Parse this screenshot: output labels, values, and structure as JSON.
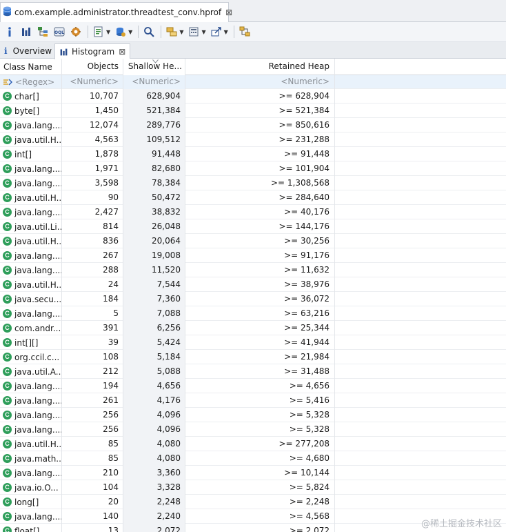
{
  "editor_tab": {
    "title": "com.example.administrator.threadtest_conv.hprof",
    "close": "⊠",
    "icon": "database-icon"
  },
  "toolbar": {
    "buttons": [
      "info-icon",
      "histogram-icon",
      "dominator-tree-icon",
      "oql-icon",
      "thread-overview-icon",
      "run-report-icon",
      "query-browser-icon",
      "find-object-icon",
      "group-by-icon",
      "calculate-retained-icon",
      "export-icon",
      "heap-dump-overview-icon"
    ],
    "oql_label": "OQL"
  },
  "view_tabs": [
    {
      "label": "Overview",
      "icon": "i"
    },
    {
      "label": "Histogram",
      "close": "⊠"
    }
  ],
  "table": {
    "columns": [
      "Class Name",
      "Objects",
      "Shallow He...",
      "Retained Heap"
    ],
    "filter": {
      "class_name": "<Regex>",
      "objects": "<Numeric>",
      "shallow": "<Numeric>",
      "retained": "<Numeric>"
    },
    "class_icon_letter": "C",
    "rows": [
      {
        "name": "char[]",
        "objects": "10,707",
        "shallow": "628,904",
        "retained": ">= 628,904"
      },
      {
        "name": "byte[]",
        "objects": "1,450",
        "shallow": "521,384",
        "retained": ">= 521,384"
      },
      {
        "name": "java.lang....",
        "objects": "12,074",
        "shallow": "289,776",
        "retained": ">= 850,616"
      },
      {
        "name": "java.util.H...",
        "objects": "4,563",
        "shallow": "109,512",
        "retained": ">= 231,288"
      },
      {
        "name": "int[]",
        "objects": "1,878",
        "shallow": "91,448",
        "retained": ">= 91,448"
      },
      {
        "name": "java.lang....",
        "objects": "1,971",
        "shallow": "82,680",
        "retained": ">= 101,904"
      },
      {
        "name": "java.lang....",
        "objects": "3,598",
        "shallow": "78,384",
        "retained": ">= 1,308,568"
      },
      {
        "name": "java.util.H...",
        "objects": "90",
        "shallow": "50,472",
        "retained": ">= 284,640"
      },
      {
        "name": "java.lang....",
        "objects": "2,427",
        "shallow": "38,832",
        "retained": ">= 40,176"
      },
      {
        "name": "java.util.Li...",
        "objects": "814",
        "shallow": "26,048",
        "retained": ">= 144,176"
      },
      {
        "name": "java.util.H...",
        "objects": "836",
        "shallow": "20,064",
        "retained": ">= 30,256"
      },
      {
        "name": "java.lang....",
        "objects": "267",
        "shallow": "19,008",
        "retained": ">= 91,176"
      },
      {
        "name": "java.lang....",
        "objects": "288",
        "shallow": "11,520",
        "retained": ">= 11,632"
      },
      {
        "name": "java.util.H...",
        "objects": "24",
        "shallow": "7,544",
        "retained": ">= 38,976"
      },
      {
        "name": "java.secu...",
        "objects": "184",
        "shallow": "7,360",
        "retained": ">= 36,072"
      },
      {
        "name": "java.lang....",
        "objects": "5",
        "shallow": "7,088",
        "retained": ">= 63,216"
      },
      {
        "name": "com.andr...",
        "objects": "391",
        "shallow": "6,256",
        "retained": ">= 25,344"
      },
      {
        "name": "int[][]",
        "objects": "39",
        "shallow": "5,424",
        "retained": ">= 41,944"
      },
      {
        "name": "org.ccil.c...",
        "objects": "108",
        "shallow": "5,184",
        "retained": ">= 21,984"
      },
      {
        "name": "java.util.A...",
        "objects": "212",
        "shallow": "5,088",
        "retained": ">= 31,488"
      },
      {
        "name": "java.lang....",
        "objects": "194",
        "shallow": "4,656",
        "retained": ">= 4,656"
      },
      {
        "name": "java.lang....",
        "objects": "261",
        "shallow": "4,176",
        "retained": ">= 5,416"
      },
      {
        "name": "java.lang....",
        "objects": "256",
        "shallow": "4,096",
        "retained": ">= 5,328"
      },
      {
        "name": "java.lang....",
        "objects": "256",
        "shallow": "4,096",
        "retained": ">= 5,328"
      },
      {
        "name": "java.util.H...",
        "objects": "85",
        "shallow": "4,080",
        "retained": ">= 277,208"
      },
      {
        "name": "java.math...",
        "objects": "85",
        "shallow": "4,080",
        "retained": ">= 4,680"
      },
      {
        "name": "java.lang....",
        "objects": "210",
        "shallow": "3,360",
        "retained": ">= 10,144"
      },
      {
        "name": "java.io.O...",
        "objects": "104",
        "shallow": "3,328",
        "retained": ">= 5,824"
      },
      {
        "name": "long[]",
        "objects": "20",
        "shallow": "2,248",
        "retained": ">= 2,248"
      },
      {
        "name": "java.lang....",
        "objects": "140",
        "shallow": "2,240",
        "retained": ">= 4,568"
      },
      {
        "name": "float[]",
        "objects": "13",
        "shallow": "2,072",
        "retained": ">= 2,072"
      }
    ]
  },
  "watermark": "@稀土掘金技术社区"
}
